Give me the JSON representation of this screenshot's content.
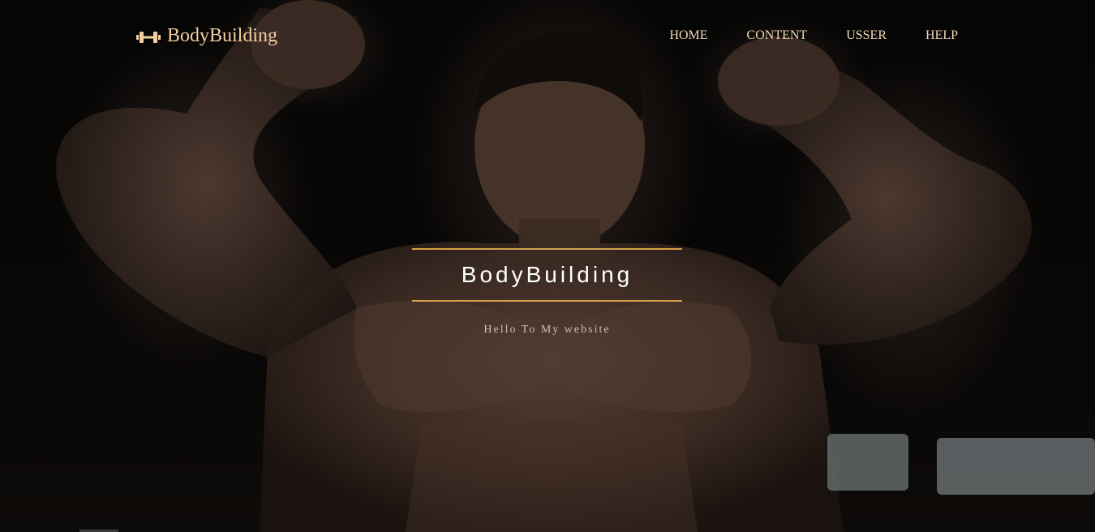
{
  "brand": {
    "icon": "dumbbell-icon",
    "name": "BodyBuilding"
  },
  "nav": {
    "items": [
      {
        "label": "HOME"
      },
      {
        "label": "CONTENT"
      },
      {
        "label": "USSER"
      },
      {
        "label": "HELP"
      }
    ]
  },
  "hero": {
    "title": "BodyBuilding",
    "subtitle": "Hello To My website",
    "background_image": "bodybuilder-flexing-photo"
  },
  "colors": {
    "accent": "#d4a04a",
    "nav_text": "#f3d8b4",
    "brand_text": "#f3cfa0",
    "title_text": "#ffffff"
  }
}
